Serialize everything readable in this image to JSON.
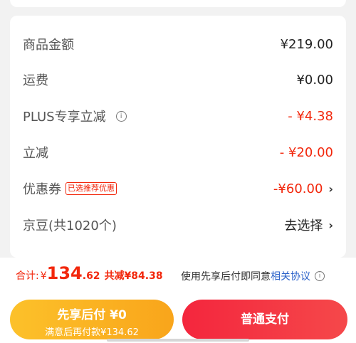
{
  "summary": {
    "rows": [
      {
        "label": "商品金额",
        "value": "¥219.00"
      },
      {
        "label": "运费",
        "value": "¥0.00"
      },
      {
        "label": "PLUS专享立减",
        "value": "- ¥4.38"
      },
      {
        "label": "立减",
        "value": "- ¥20.00"
      },
      {
        "label": "优惠券",
        "tag": "已选推荐优惠",
        "value": "-¥60.00"
      },
      {
        "label": "京豆(共1020个)",
        "value": "去选择"
      }
    ]
  },
  "footer": {
    "total_label": "合计:",
    "currency": "¥",
    "total_int": "134",
    "total_dec": ".62",
    "saved": "共减¥84.38",
    "agree_text": "使用先享后付即同意",
    "agree_link": "相关协议",
    "btn_pay_later_title": "先享后付 ¥0",
    "btn_pay_later_sub": "满意后再付款¥134.62",
    "btn_normal": "普通支付"
  },
  "colors": {
    "accent_red": "#f2270c",
    "btn_yellow": "#fcc12a",
    "btn_red": "#f4263d",
    "link": "#2a61c9"
  }
}
